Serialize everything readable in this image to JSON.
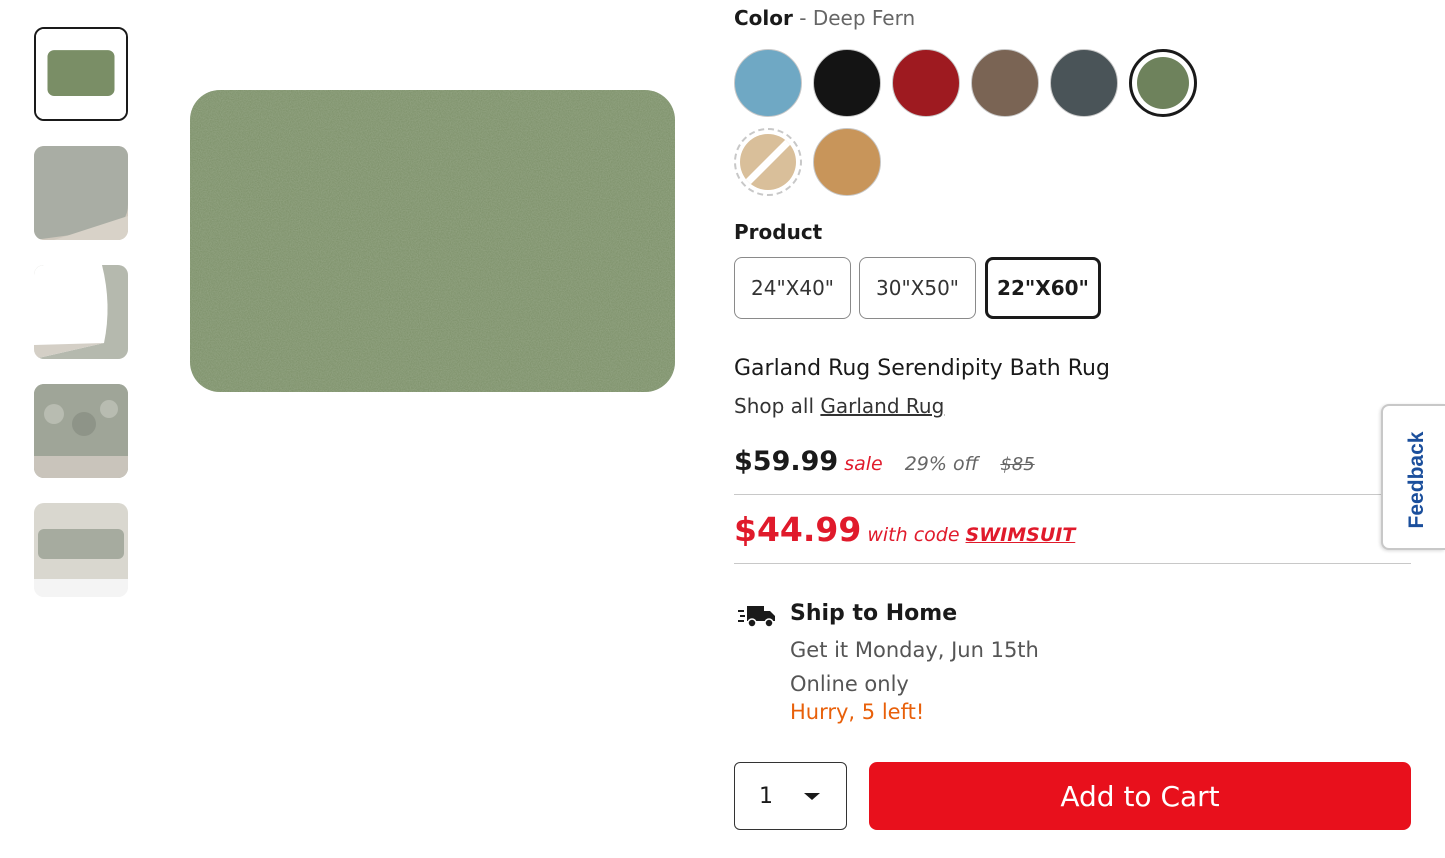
{
  "gallery": {
    "thumbnails": [
      {
        "name": "thumbnail-front",
        "selected": true
      },
      {
        "name": "thumbnail-corner"
      },
      {
        "name": "thumbnail-backing"
      },
      {
        "name": "thumbnail-closeup"
      },
      {
        "name": "thumbnail-room"
      }
    ],
    "main_color": "#7a8e66"
  },
  "color": {
    "label": "Color",
    "separator": "-",
    "selected_value": "Deep Fern",
    "swatches": [
      {
        "name": "swatch-blue",
        "color": "#6fa8c4"
      },
      {
        "name": "swatch-black",
        "color": "#141414"
      },
      {
        "name": "swatch-red",
        "color": "#9e1a20"
      },
      {
        "name": "swatch-brown",
        "color": "#7a6454"
      },
      {
        "name": "swatch-slate",
        "color": "#4a5458"
      },
      {
        "name": "swatch-deep-fern",
        "color": "#6e825c",
        "selected": true
      },
      {
        "name": "swatch-linen-unavailable",
        "color": "#d9bf9a",
        "unavailable": true
      },
      {
        "name": "swatch-tan",
        "color": "#c8955a"
      }
    ]
  },
  "product": {
    "label": "Product",
    "sizes": [
      "24\"X40\"",
      "30\"X50\"",
      "22\"X60\""
    ],
    "selected_size": "22\"X60\""
  },
  "title": "Garland Rug Serendipity Bath Rug",
  "brand": {
    "prefix": "Shop all",
    "name": "Garland Rug"
  },
  "pricing": {
    "price": "$59.99",
    "sale_label": "sale",
    "discount": "29% off",
    "original": "$85",
    "promo_price": "$44.99",
    "promo_text": "with code",
    "promo_code": "SWIMSUIT"
  },
  "shipping": {
    "icon": "truck-icon",
    "title": "Ship to Home",
    "delivery": "Get it Monday, Jun 15th",
    "availability": "Online only",
    "stock_alert": "Hurry, 5 left!"
  },
  "cart": {
    "quantity": "1",
    "add_label": "Add to Cart"
  },
  "feedback_tab": "Feedback",
  "colors": {
    "sale_red": "#e01a2b",
    "button_red": "#e8101c",
    "hurry_orange": "#e8600a",
    "feedback_blue": "#1b4f9c"
  }
}
